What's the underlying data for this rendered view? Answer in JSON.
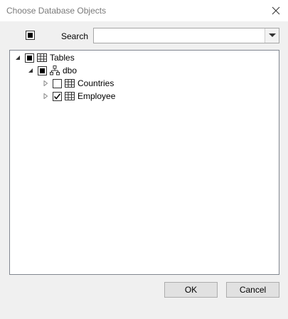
{
  "window": {
    "title": "Choose Database Objects",
    "close_icon": "close-icon"
  },
  "toolbar": {
    "select_all_state": "partial",
    "search_label": "Search",
    "search_value": "",
    "search_placeholder": ""
  },
  "tree": {
    "root": {
      "label": "Tables",
      "icon": "table-icon",
      "expanded": true,
      "state": "partial",
      "children": [
        {
          "label": "dbo",
          "icon": "schema-icon",
          "expanded": true,
          "state": "partial",
          "children": [
            {
              "label": "Countries",
              "icon": "table-icon",
              "expanded": false,
              "state": "unchecked"
            },
            {
              "label": "Employee",
              "icon": "table-icon",
              "expanded": false,
              "state": "checked"
            }
          ]
        }
      ]
    }
  },
  "buttons": {
    "ok_label": "OK",
    "cancel_label": "Cancel"
  }
}
